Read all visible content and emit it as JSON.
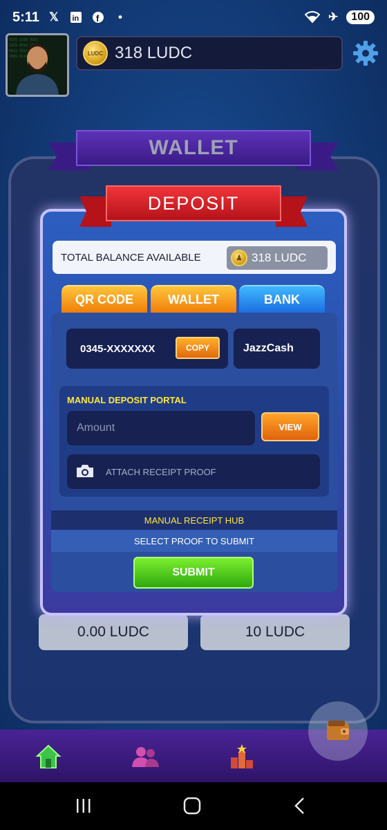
{
  "status_bar": {
    "time": "5:11",
    "battery": "100",
    "icons": [
      "x-icon",
      "linkedin-icon",
      "facebook-icon",
      "dot-icon",
      "wifi-icon",
      "airplane-icon"
    ]
  },
  "header": {
    "balance": "318 LUDC",
    "coin_label": "LUDC"
  },
  "wallet": {
    "title": "WALLET"
  },
  "deposit": {
    "title": "DEPOSIT",
    "total_label": "TOTAL BALANCE AVAILABLE",
    "total_value": "318 LUDC",
    "tabs": [
      {
        "label": "QR CODE",
        "active": false
      },
      {
        "label": "WALLET",
        "active": false
      },
      {
        "label": "BANK",
        "active": true
      }
    ],
    "account_number": "0345-XXXXXXX",
    "copy_label": "COPY",
    "provider": "JazzCash",
    "portal_title": "MANUAL DEPOSIT PORTAL",
    "amount_placeholder": "Amount",
    "view_label": "VIEW",
    "attach_label": "ATTACH RECEIPT PROOF",
    "hub_label": "MANUAL RECEIPT HUB",
    "proof_label": "SELECT PROOF TO SUBMIT",
    "submit_label": "SUBMIT"
  },
  "balance_cards": [
    "0.00 LUDC",
    "10 LUDC"
  ],
  "colors": {
    "accent_orange": "#f07e0c",
    "tab_active": "#1c6ee0",
    "submit_green": "#2fa80f",
    "ribbon_red": "#b5121a",
    "portal_yellow": "#ffe93a"
  }
}
